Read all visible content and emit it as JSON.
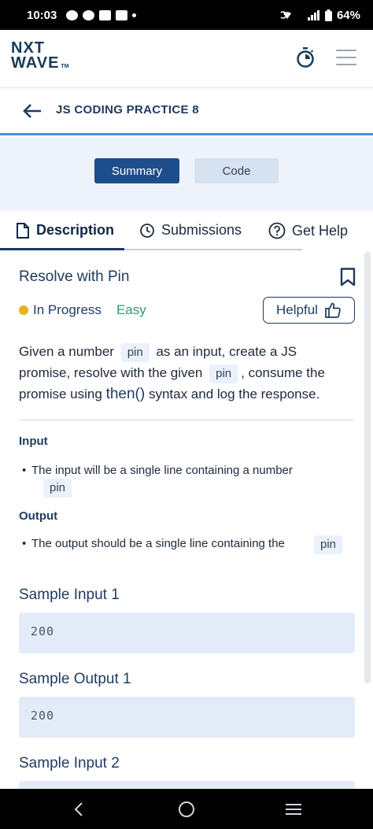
{
  "status_bar": {
    "time": "10:03",
    "battery": "64%"
  },
  "header": {
    "logo_line1": "NXT",
    "logo_line2": "WAVE",
    "logo_tm": "TM"
  },
  "title_bar": {
    "title": "JS CODING PRACTICE 8"
  },
  "switch": {
    "summary_label": "Summary",
    "code_label": "Code"
  },
  "tabs": [
    {
      "label": "Description"
    },
    {
      "label": "Submissions"
    },
    {
      "label": "Get Help"
    }
  ],
  "problem": {
    "title": "Resolve with Pin",
    "status": "In Progress",
    "difficulty": "Easy",
    "helpful_label": "Helpful",
    "desc_1": "Given a number",
    "desc_chip_1": "pin",
    "desc_2": "as an input, create a JS promise, resolve with the given",
    "desc_chip_2": "pin",
    "desc_3": ", consume the promise using",
    "desc_kw": "then()",
    "desc_4": "syntax and log the response."
  },
  "input_section": {
    "label": "Input",
    "bullet": "The input will be a single line containing a number",
    "chip": "pin"
  },
  "output_section": {
    "label": "Output",
    "bullet": "The output should be a single line containing the",
    "chip": "pin"
  },
  "samples": [
    {
      "title": "Sample Input 1",
      "value": "200"
    },
    {
      "title": "Sample Output 1",
      "value": "200"
    },
    {
      "title": "Sample Input 2",
      "value": ""
    }
  ]
}
